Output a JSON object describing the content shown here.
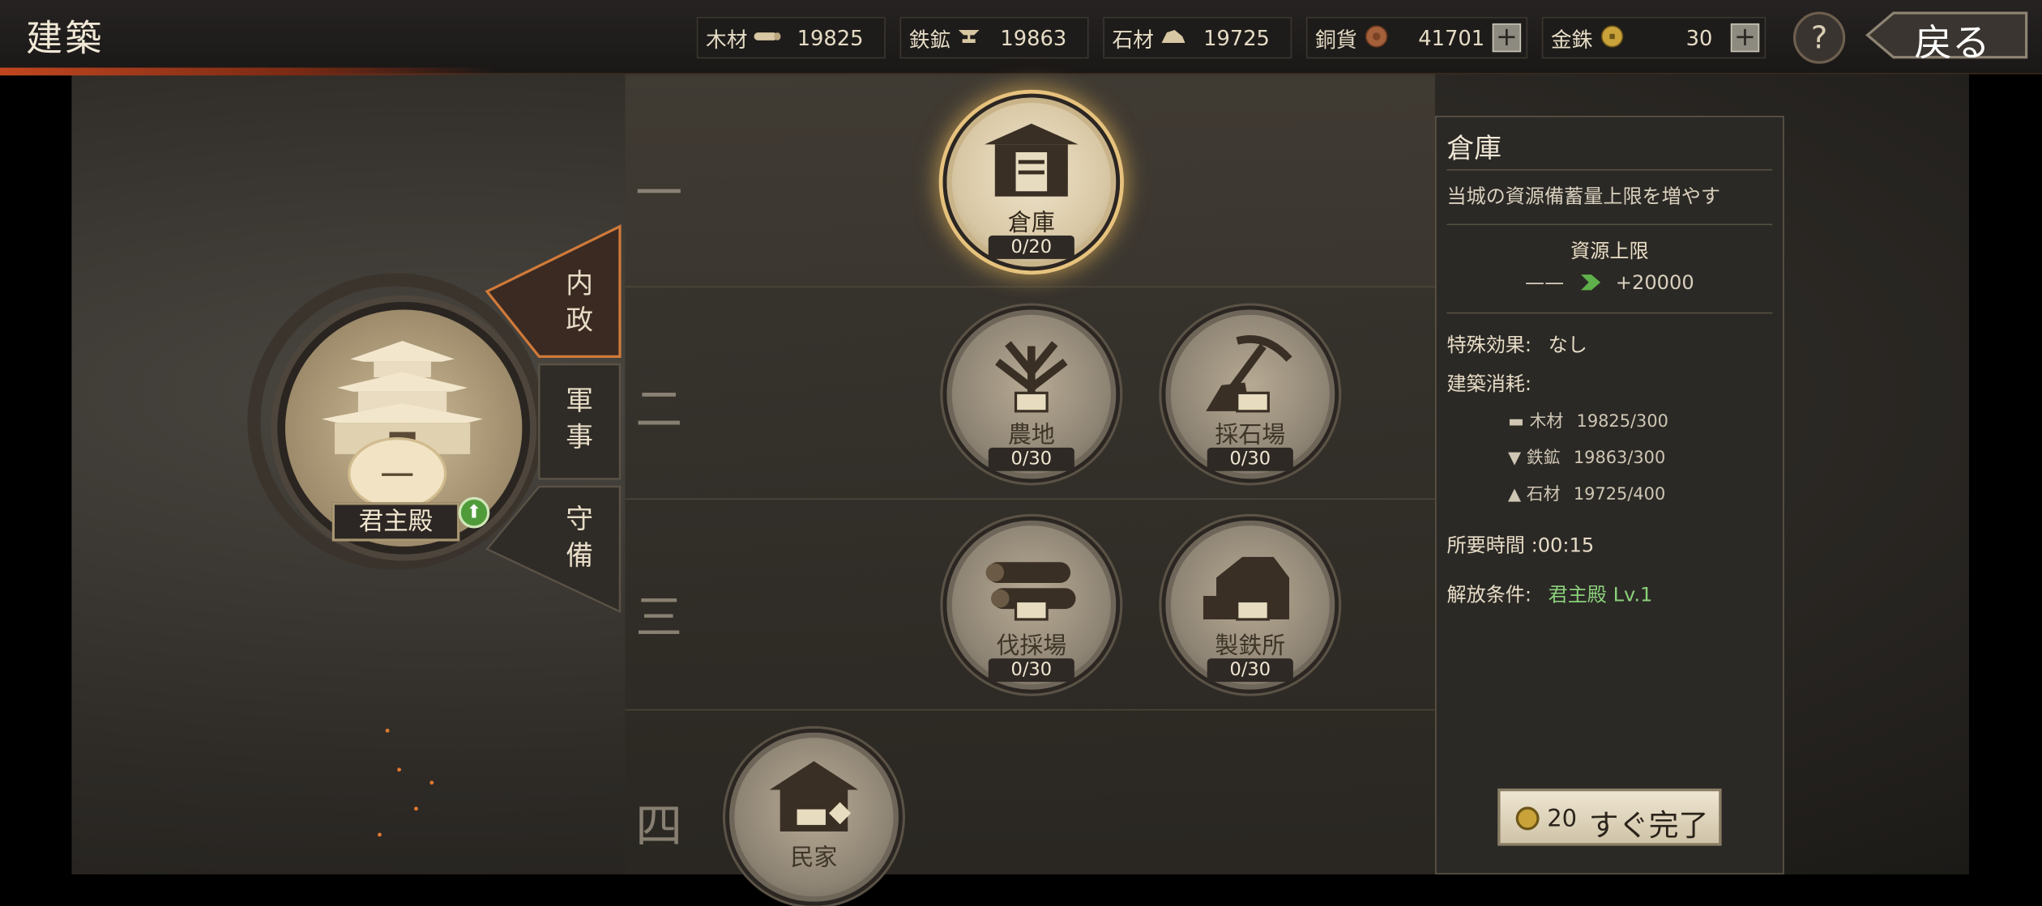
{
  "header": {
    "title": "建築",
    "back_label": "戻る",
    "help_label": "?"
  },
  "resources": [
    {
      "label": "木材",
      "icon": "wood-icon",
      "value": "19825"
    },
    {
      "label": "鉄鉱",
      "icon": "anvil-icon",
      "value": "19863"
    },
    {
      "label": "石材",
      "icon": "stone-icon",
      "value": "19725"
    },
    {
      "label": "銅貨",
      "icon": "copper-coin-icon",
      "value": "41701",
      "plus": "+"
    },
    {
      "label": "金銖",
      "icon": "gold-coin-icon",
      "value": "30",
      "plus": "+"
    }
  ],
  "tiers": [
    "一",
    "二",
    "三",
    "四"
  ],
  "main_hall": {
    "name": "君主殿",
    "level": "一"
  },
  "tabs": [
    "内政",
    "軍事",
    "守備"
  ],
  "buildings": [
    {
      "name": "倉庫",
      "count": "0/20",
      "selected": true
    },
    {
      "name": "農地",
      "count": "0/30"
    },
    {
      "name": "採石場",
      "count": "0/30"
    },
    {
      "name": "伐採場",
      "count": "0/30"
    },
    {
      "name": "製鉄所",
      "count": "0/30"
    },
    {
      "name": "民家",
      "count": ""
    }
  ],
  "detail": {
    "title": "倉庫",
    "description": "当城の資源備蓄量上限を増やす",
    "cap_heading": "資源上限",
    "cap_from": "——",
    "cap_to": "+20000",
    "special_label": "特殊効果:",
    "special_value": "なし",
    "cost_label": "建築消耗:",
    "costs": [
      {
        "name": "木材",
        "value": "19825/300"
      },
      {
        "name": "鉄鉱",
        "value": "19863/300"
      },
      {
        "name": "石材",
        "value": "19725/400"
      }
    ],
    "time_label": "所要時間 :",
    "time_value": "00:15",
    "unlock_label": "解放条件:",
    "unlock_value": "君主殿 Lv.1",
    "finish_amount": "20",
    "finish_label": "すぐ完了"
  }
}
